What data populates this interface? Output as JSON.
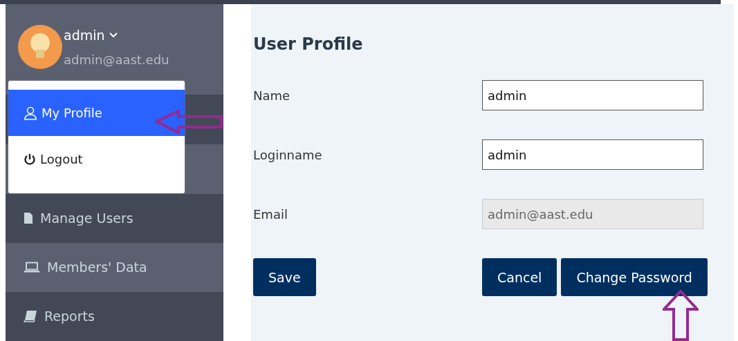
{
  "user": {
    "name": "admin",
    "email": "admin@aast.edu"
  },
  "user_menu": [
    {
      "label": "My Profile",
      "selected": true
    },
    {
      "label": "Logout",
      "selected": false
    }
  ],
  "sidebar": {
    "items": [
      {
        "label": "Manage Users",
        "selected": false
      },
      {
        "label": "Members' Data",
        "selected": true
      },
      {
        "label": "Reports",
        "selected": false
      }
    ]
  },
  "main": {
    "title": "User Profile",
    "fields": [
      {
        "label": "Name",
        "value": "admin",
        "disabled": false
      },
      {
        "label": "Loginname",
        "value": "admin",
        "disabled": false
      },
      {
        "label": "Email",
        "value": "admin@aast.edu",
        "disabled": true
      }
    ],
    "buttons": {
      "left": [
        "Save"
      ],
      "right": [
        "Cancel",
        "Change Password"
      ]
    }
  }
}
